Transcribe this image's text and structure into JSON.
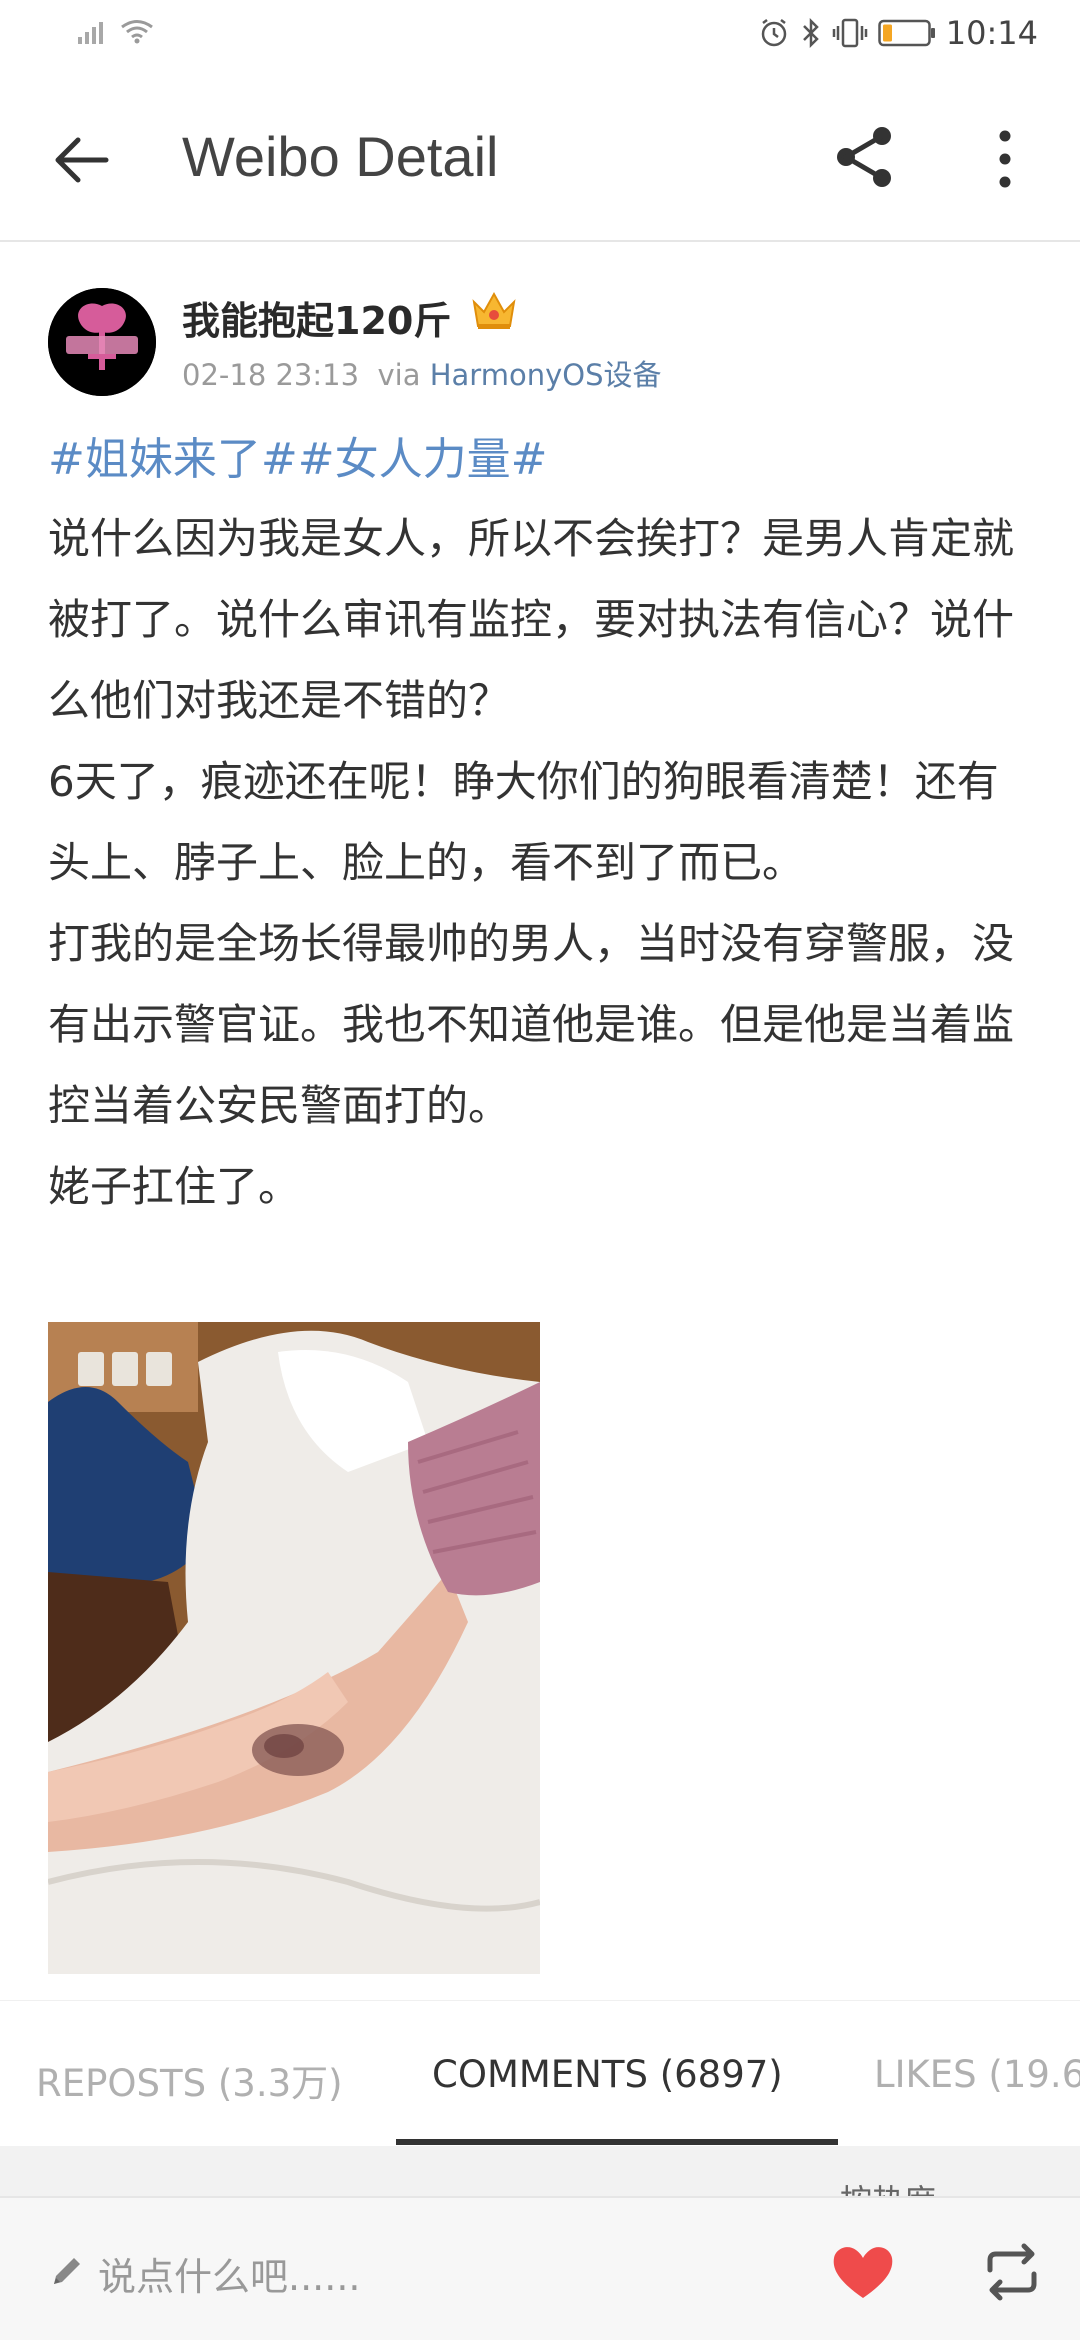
{
  "status_bar": {
    "time": "10:14",
    "icons": [
      "signal-icon",
      "wifi-icon",
      "alarm-icon",
      "bluetooth-icon",
      "vibrate-icon",
      "battery-icon"
    ],
    "battery_color": "#f5a623"
  },
  "app_bar": {
    "title": "Weibo Detail",
    "icons": [
      "back-arrow-icon",
      "share-icon",
      "more-vertical-icon"
    ]
  },
  "post": {
    "username": "我能抱起120斤",
    "badge_icon": "crown-icon",
    "timestamp": "02-18 23:13",
    "via_label": "via",
    "source": "HarmonyOS设备",
    "hashtags": "#姐妹来了##女人力量#",
    "paragraphs": [
      "说什么因为我是女人，所以不会挨打？是男人肯定就被打了。说什么审讯有监控，要对执法有信心？说什么他们对我还是不错的？",
      "6天了，痕迹还在呢！睁大你们的狗眼看清楚！还有头上、脖子上、脸上的，看不到了而已。",
      "打我的是全场长得最帅的男人，当时没有穿警服，没有出示警官证。我也不知道他是谁。但是他是当着监控当着公安民警面打的。",
      "姥子扛住了。"
    ],
    "hashtag_color": "#5b8bc5",
    "source_color": "#5b7fa8"
  },
  "tabs": [
    {
      "label": "REPOSTS (3.3万)",
      "active": false
    },
    {
      "label": "COMMENTS (6897)",
      "active": true
    },
    {
      "label": "LIKES (19.6",
      "active": false
    }
  ],
  "comments": {
    "sort_label": "按热度"
  },
  "bottom_bar": {
    "placeholder": "说点什么吧......",
    "like_color": "#ef4b4b"
  }
}
